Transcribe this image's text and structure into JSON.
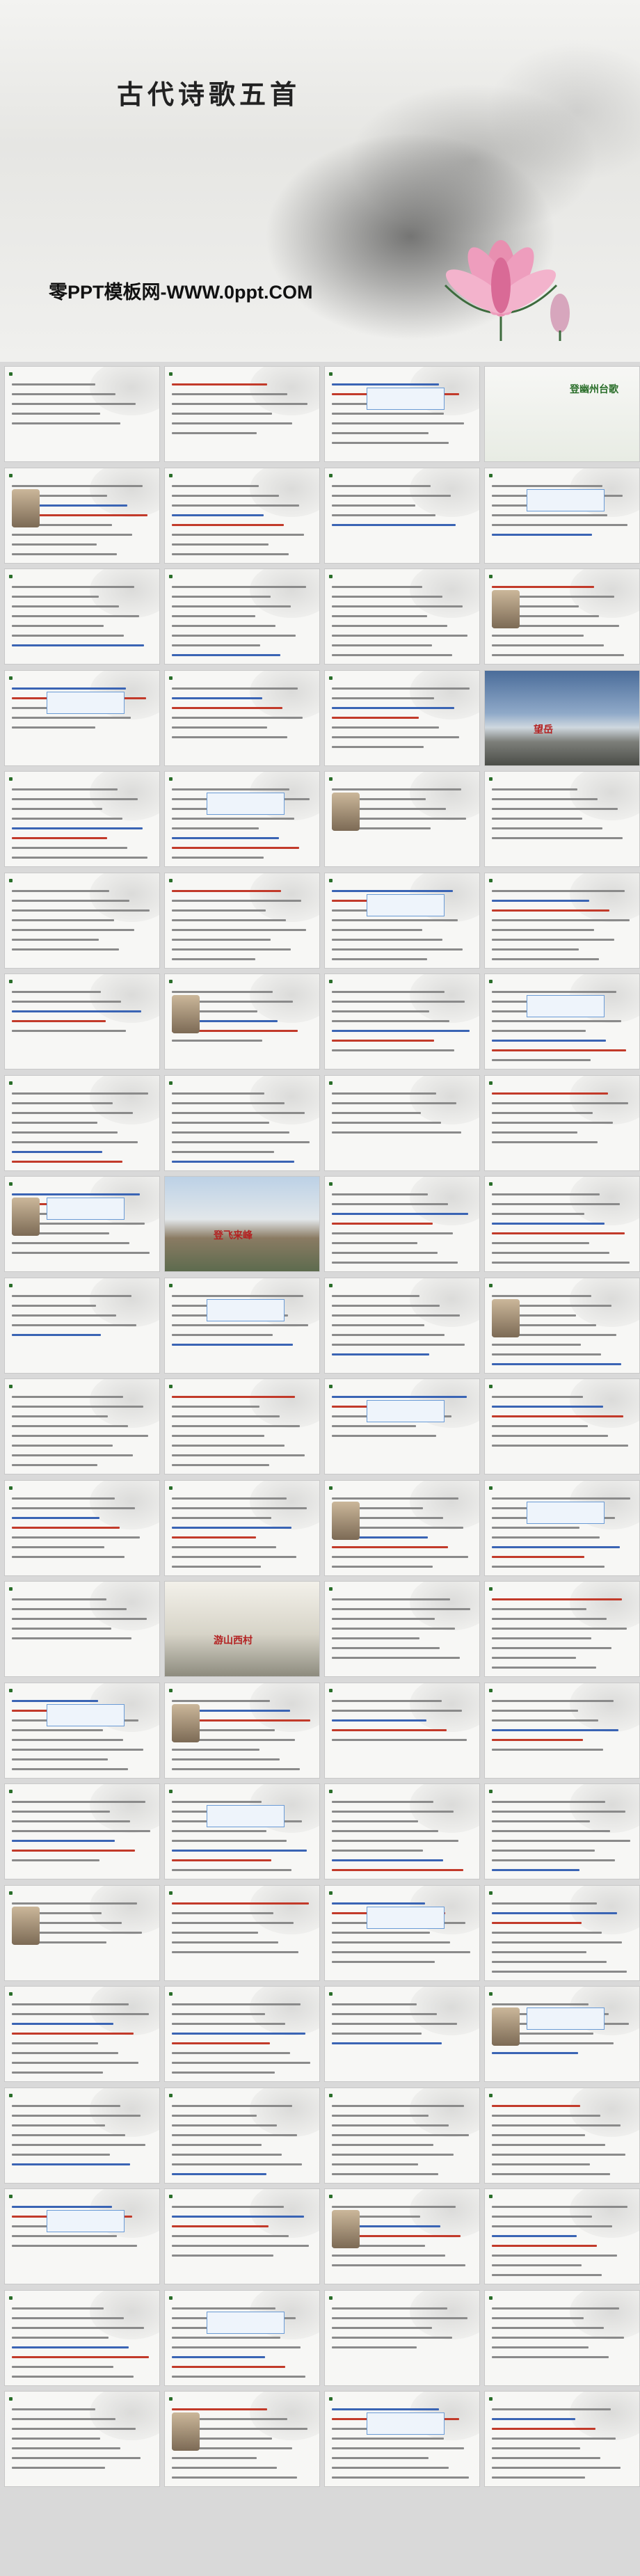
{
  "cover": {
    "title": "古代诗歌五首",
    "subtitle": "零PPT模板网-WWW.0ppt.COM"
  },
  "slides": [
    {
      "header": "",
      "caption": "",
      "photo": ""
    },
    {
      "header": "",
      "caption": "",
      "photo": ""
    },
    {
      "header": "",
      "caption": "",
      "photo": ""
    },
    {
      "header": "",
      "caption": "登幽州台歌",
      "photo": "poem-card"
    },
    {
      "header": "",
      "caption": "",
      "photo": ""
    },
    {
      "header": "",
      "caption": "",
      "photo": ""
    },
    {
      "header": "",
      "caption": "",
      "photo": ""
    },
    {
      "header": "",
      "caption": "",
      "photo": ""
    },
    {
      "header": "",
      "caption": "",
      "photo": ""
    },
    {
      "header": "",
      "caption": "",
      "photo": ""
    },
    {
      "header": "",
      "caption": "",
      "photo": ""
    },
    {
      "header": "",
      "caption": "",
      "photo": ""
    },
    {
      "header": "",
      "caption": "",
      "photo": ""
    },
    {
      "header": "",
      "caption": "",
      "photo": ""
    },
    {
      "header": "",
      "caption": "",
      "photo": ""
    },
    {
      "header": "",
      "caption": "望岳",
      "photo": "mountain"
    },
    {
      "header": "",
      "caption": "",
      "photo": ""
    },
    {
      "header": "",
      "caption": "",
      "photo": ""
    },
    {
      "header": "",
      "caption": "",
      "photo": ""
    },
    {
      "header": "",
      "caption": "",
      "photo": ""
    },
    {
      "header": "",
      "caption": "",
      "photo": ""
    },
    {
      "header": "",
      "caption": "",
      "photo": ""
    },
    {
      "header": "",
      "caption": "",
      "photo": ""
    },
    {
      "header": "",
      "caption": "",
      "photo": ""
    },
    {
      "header": "",
      "caption": "",
      "photo": ""
    },
    {
      "header": "",
      "caption": "",
      "photo": ""
    },
    {
      "header": "",
      "caption": "",
      "photo": ""
    },
    {
      "header": "",
      "caption": "",
      "photo": ""
    },
    {
      "header": "",
      "caption": "",
      "photo": ""
    },
    {
      "header": "",
      "caption": "",
      "photo": ""
    },
    {
      "header": "",
      "caption": "",
      "photo": ""
    },
    {
      "header": "",
      "caption": "",
      "photo": ""
    },
    {
      "header": "",
      "caption": "",
      "photo": ""
    },
    {
      "header": "",
      "caption": "登飞来峰",
      "photo": "great-wall"
    },
    {
      "header": "",
      "caption": "",
      "photo": ""
    },
    {
      "header": "",
      "caption": "",
      "photo": ""
    },
    {
      "header": "",
      "caption": "",
      "photo": ""
    },
    {
      "header": "",
      "caption": "",
      "photo": ""
    },
    {
      "header": "",
      "caption": "",
      "photo": ""
    },
    {
      "header": "",
      "caption": "",
      "photo": ""
    },
    {
      "header": "",
      "caption": "",
      "photo": ""
    },
    {
      "header": "",
      "caption": "",
      "photo": ""
    },
    {
      "header": "",
      "caption": "",
      "photo": ""
    },
    {
      "header": "",
      "caption": "",
      "photo": ""
    },
    {
      "header": "",
      "caption": "",
      "photo": ""
    },
    {
      "header": "",
      "caption": "",
      "photo": ""
    },
    {
      "header": "",
      "caption": "",
      "photo": ""
    },
    {
      "header": "",
      "caption": "",
      "photo": ""
    },
    {
      "header": "",
      "caption": "",
      "photo": ""
    },
    {
      "header": "",
      "caption": "游山西村",
      "photo": "village"
    },
    {
      "header": "",
      "caption": "",
      "photo": ""
    },
    {
      "header": "",
      "caption": "",
      "photo": ""
    },
    {
      "header": "",
      "caption": "",
      "photo": ""
    },
    {
      "header": "",
      "caption": "",
      "photo": ""
    },
    {
      "header": "",
      "caption": "",
      "photo": ""
    },
    {
      "header": "",
      "caption": "",
      "photo": ""
    },
    {
      "header": "",
      "caption": "",
      "photo": ""
    },
    {
      "header": "",
      "caption": "",
      "photo": ""
    },
    {
      "header": "",
      "caption": "",
      "photo": ""
    },
    {
      "header": "",
      "caption": "",
      "photo": ""
    },
    {
      "header": "",
      "caption": "",
      "photo": ""
    },
    {
      "header": "",
      "caption": "",
      "photo": ""
    },
    {
      "header": "",
      "caption": "",
      "photo": ""
    },
    {
      "header": "",
      "caption": "",
      "photo": ""
    },
    {
      "header": "",
      "caption": "",
      "photo": ""
    },
    {
      "header": "",
      "caption": "",
      "photo": ""
    },
    {
      "header": "",
      "caption": "",
      "photo": ""
    },
    {
      "header": "",
      "caption": "",
      "photo": ""
    },
    {
      "header": "",
      "caption": "",
      "photo": ""
    },
    {
      "header": "",
      "caption": "",
      "photo": ""
    },
    {
      "header": "",
      "caption": "",
      "photo": ""
    },
    {
      "header": "",
      "caption": "",
      "photo": ""
    },
    {
      "header": "",
      "caption": "",
      "photo": ""
    },
    {
      "header": "",
      "caption": "",
      "photo": ""
    },
    {
      "header": "",
      "caption": "",
      "photo": ""
    },
    {
      "header": "",
      "caption": "",
      "photo": ""
    },
    {
      "header": "",
      "caption": "",
      "photo": ""
    },
    {
      "header": "",
      "caption": "",
      "photo": ""
    },
    {
      "header": "",
      "caption": "",
      "photo": ""
    },
    {
      "header": "",
      "caption": "",
      "photo": ""
    },
    {
      "header": "",
      "caption": "",
      "photo": ""
    },
    {
      "header": "",
      "caption": "",
      "photo": ""
    },
    {
      "header": "",
      "caption": "",
      "photo": ""
    },
    {
      "header": "",
      "caption": "",
      "photo": ""
    }
  ],
  "colors": {
    "accent_green": "#2a6e2a",
    "accent_red": "#c23a2a",
    "accent_blue": "#3a64b4"
  }
}
